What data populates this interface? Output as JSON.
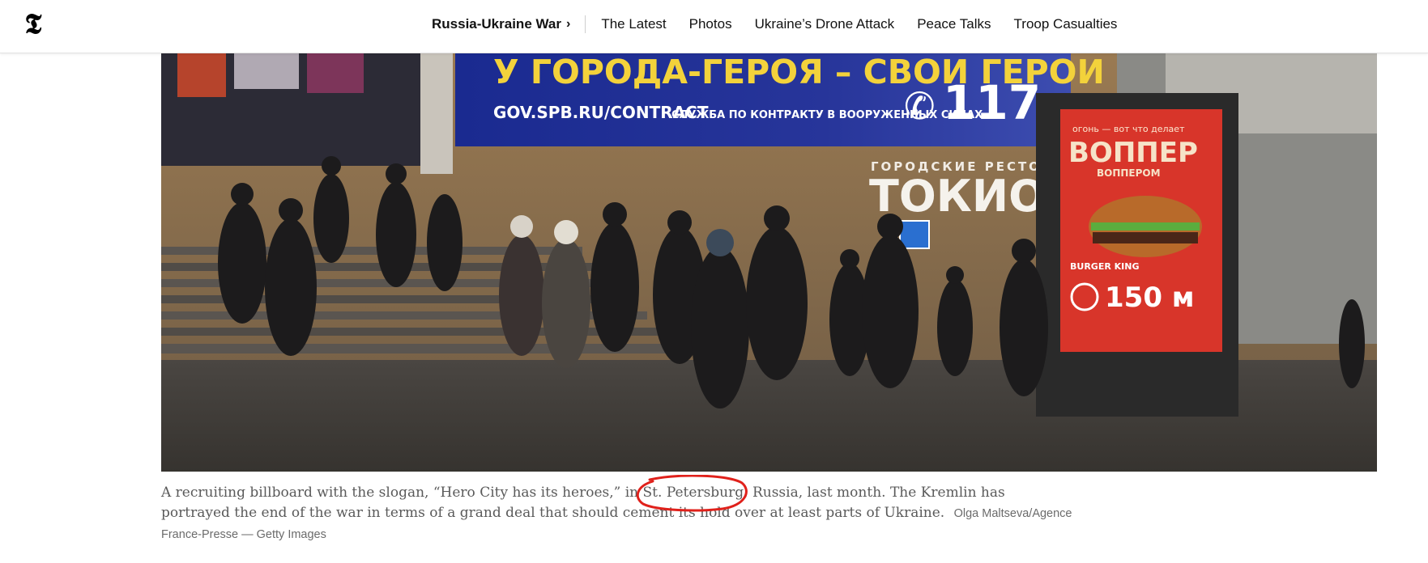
{
  "header": {
    "logo_glyph": "𝕿",
    "section_label": "Russia-Ukraine War",
    "section_chevron": "›",
    "nav_items": [
      "The Latest",
      "Photos",
      "Ukraine’s Drone Attack",
      "Peace Talks",
      "Troop Casualties"
    ]
  },
  "photo": {
    "billboard_top_text": "У ГОРОДА-ГЕРОЯ – СВОИ ГЕРОИ",
    "billboard_url": "GOV.SPB.RU/CONTRACT",
    "billboard_sub": "СЛУЖБА ПО КОНТРАКТУ В ВООРУЖЕННЫХ СИЛАХ",
    "billboard_phone": "117",
    "restaurant_small": "ГОРОДСКИЕ РЕСТОРАН",
    "restaurant_big": "ТОКИО-CITY",
    "ad_top": "огонь — вот что делает",
    "ad_title": "ВОППЕР",
    "ad_sub": "ВОППЕРОМ",
    "ad_brand": "BURGER KING",
    "ad_distance": "150 м"
  },
  "caption": {
    "before": "A recruiting billboard with the slogan, “Hero City has its heroes,” in ",
    "highlight": "St. Petersburg",
    "after": ", Russia, last month. The Kremlin has portrayed the end of the war in terms of a grand deal that should cement its hold over at least parts of Ukraine.",
    "credit": "Olga Maltseva/Agence France-Presse — Getty Images"
  },
  "colors": {
    "annotation_circle": "#e0211b",
    "billboard_blue": "#1e2a8a",
    "billboard_yellow": "#f3d23b"
  }
}
